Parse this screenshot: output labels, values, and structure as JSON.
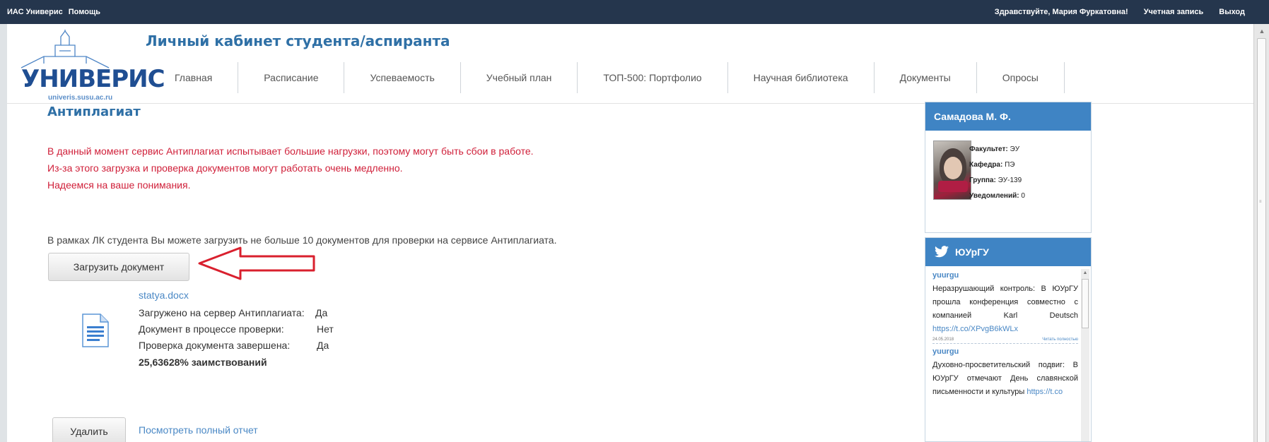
{
  "topbar": {
    "app_name": "ИАС Универис",
    "help": "Помощь",
    "greeting": "Здравствуйте, Мария Фуркатовна!",
    "account": "Учетная запись",
    "logout": "Выход"
  },
  "header": {
    "logo_word": "УНИВЕРИС",
    "logo_url": "univeris.susu.ac.ru",
    "title": "Личный кабинет студента/аспиранта"
  },
  "nav": {
    "items": [
      "Главная",
      "Расписание",
      "Успеваемость",
      "Учебный план",
      "ТОП-500: Портфолио",
      "Научная библиотека",
      "Документы",
      "Опросы"
    ]
  },
  "main": {
    "title": "Антиплагиат",
    "warning": [
      "В данный момент сервис Антиплагиат испытывает большие нагрузки, поэтому могут быть сбои в работе.",
      "Из-за этого загрузка и проверка документов могут работать очень медленно.",
      "Надеемся на ваше понимания."
    ],
    "info": "В рамках ЛК студента Вы можете загрузить не больше 10 документов для проверки на сервисе Антиплагиата.",
    "upload_button": "Загрузить документ",
    "file": {
      "name": "statya.docx",
      "rows": [
        {
          "label": "Загружено на сервер Антиплагиата:",
          "value": "Да"
        },
        {
          "label": "Документ в процессе проверки:",
          "value": "Нет"
        },
        {
          "label": "Проверка документа завершена:",
          "value": "Да"
        }
      ],
      "result": "25,63628% заимствований"
    },
    "delete_button": "Удалить",
    "report_link": "Посмотреть полный отчет"
  },
  "profile": {
    "name": "Самадова М. Ф.",
    "fields": [
      {
        "label": "Факультет:",
        "value": "ЭУ"
      },
      {
        "label": "Кафедра:",
        "value": "ПЭ"
      },
      {
        "label": "Группа:",
        "value": "ЭУ-139"
      },
      {
        "label": "Уведомлений:",
        "value": "0"
      }
    ]
  },
  "twitter": {
    "title": "ЮУрГУ",
    "tweets": [
      {
        "user": "yuurgu",
        "text": "Неразрушающий контроль: В ЮУрГУ прошла конференция совместно с компанией Karl Deutsch",
        "link": "https://t.co/XPvgB6kWLx",
        "date": "24.05.2018",
        "action": "Читать полностью"
      },
      {
        "user": "yuurgu",
        "text": "Духовно-просветительский подвиг: В ЮУрГУ отмечают День славянской письменности и культуры",
        "link": "https://t.co"
      }
    ]
  },
  "colors": {
    "topbar": "#25364d",
    "accent_blue": "#3f84c4",
    "title_blue": "#2f70a6",
    "warning_red": "#d0203a",
    "arrow_red": "#d9202e",
    "link_blue": "#4a88c5"
  }
}
